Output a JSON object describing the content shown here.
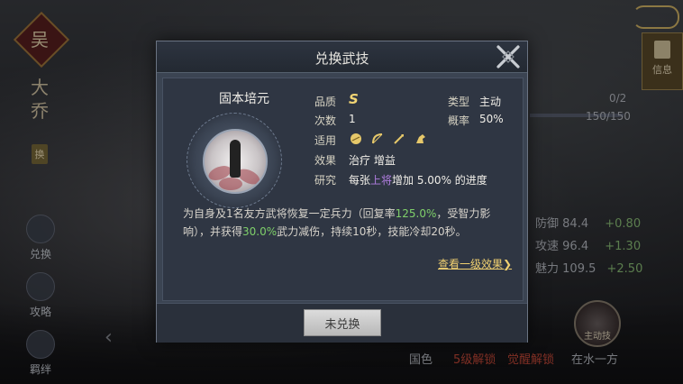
{
  "background": {
    "faction_char": "吴",
    "hero_name": "大乔",
    "swap_tag": "换",
    "rail": [
      {
        "label": "兑换"
      },
      {
        "label": "攻略"
      },
      {
        "label": "羁绊"
      }
    ],
    "info_tab": "信息",
    "progress_a": "0/2",
    "progress_b": "150/150",
    "stats": [
      {
        "name": "防御",
        "value": "84.4",
        "plus": "+0.80"
      },
      {
        "name": "攻速",
        "value": "96.4",
        "plus": "+1.30"
      },
      {
        "name": "魅力",
        "value": "109.5",
        "plus": "+2.50"
      }
    ],
    "bottom_tabs": [
      "国色",
      "5级解锁",
      "觉醒解锁",
      "在水一方"
    ],
    "round_button_label": "主动技"
  },
  "dialog": {
    "title": "兑换武技",
    "skill_name": "固本培元",
    "quality_label": "品质",
    "quality_value": "S",
    "type_label": "类型",
    "type_value": "主动",
    "count_label": "次数",
    "count_value": "1",
    "rate_label": "概率",
    "rate_value": "50%",
    "apply_label": "适用",
    "effect_label": "效果",
    "effect_value": "治疗 增益",
    "research_label": "研究",
    "research_pre": "每张",
    "research_hl": "上将",
    "research_post": "增加 5.00% 的进度",
    "desc_1": "为自身及1名友方武将恢复一定兵力（回复率",
    "desc_rate": "125.0%",
    "desc_2": "，受智力影响），并获得",
    "desc_reduce": "30.0%",
    "desc_3": "武力减伤，持续10秒，技能冷却20秒。",
    "more_link": "查看一级效果",
    "button_label": "未兑换"
  },
  "colors": {
    "grade": "#f2d574",
    "highlight_green": "#7fd06a",
    "highlight_purple": "#b07de0",
    "link": "#f0d070"
  }
}
